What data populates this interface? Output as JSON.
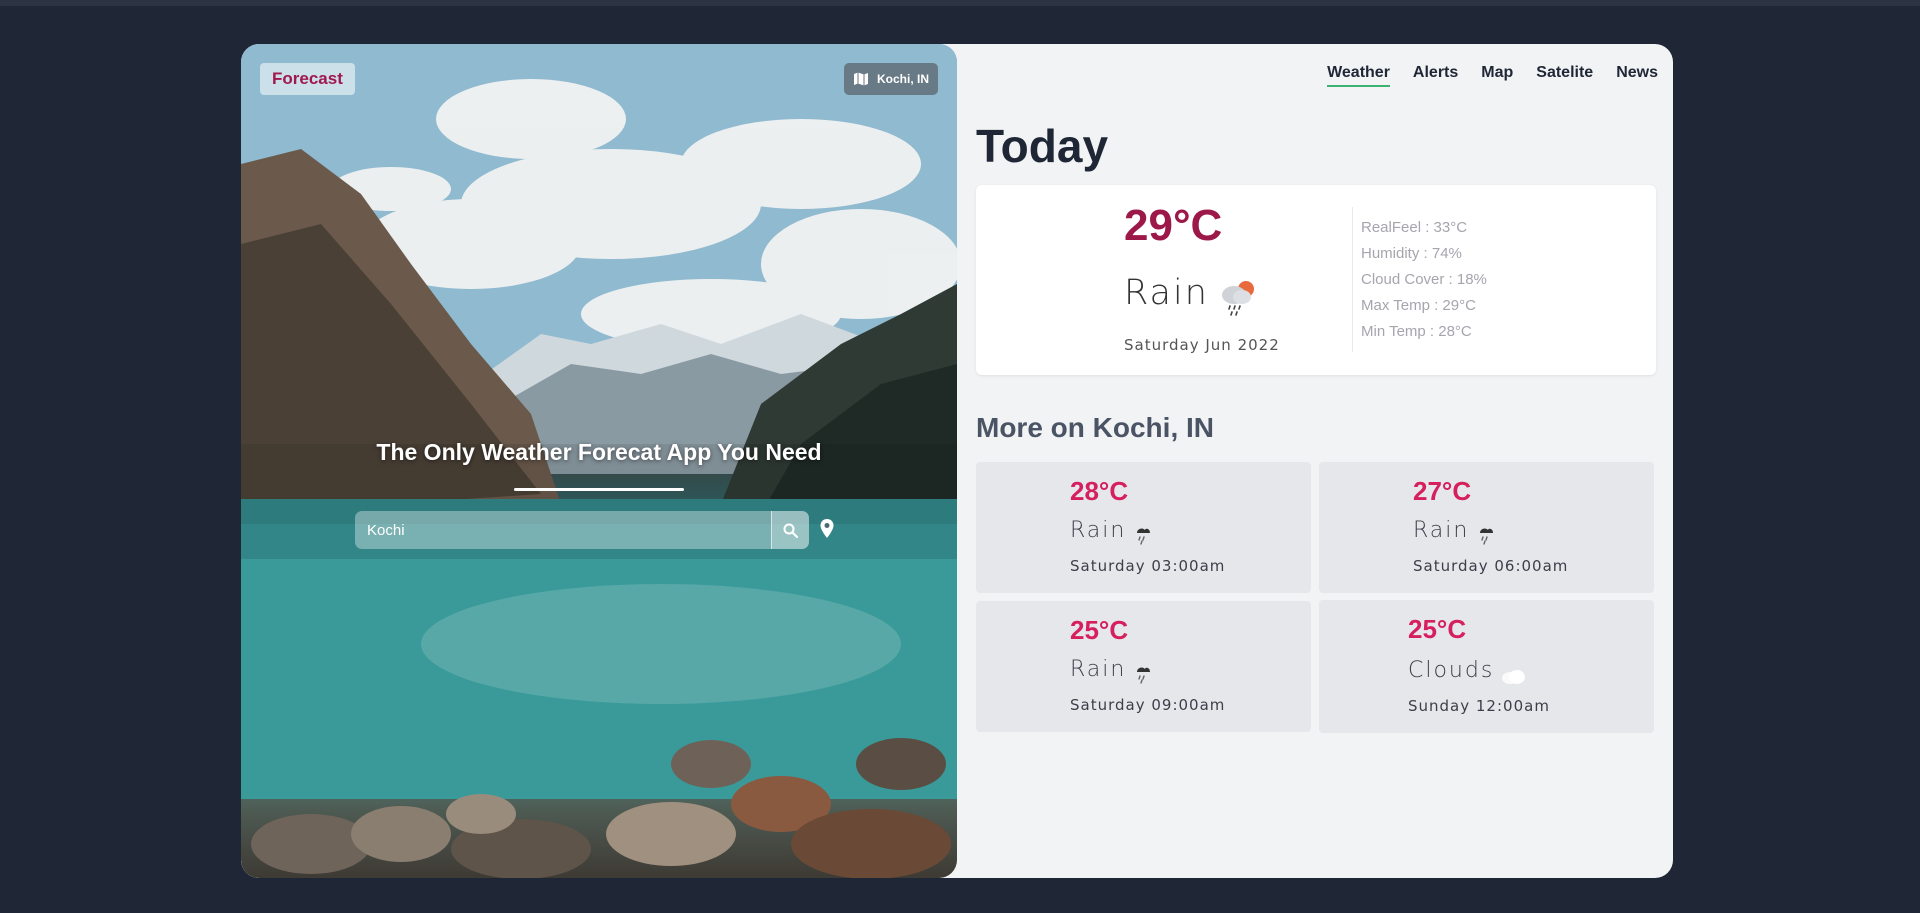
{
  "brand": "Forecast",
  "location_chip": "Kochi, IN",
  "tagline": "The Only Weather Forecat App You Need",
  "search": {
    "value": "Kochi",
    "placeholder": ""
  },
  "nav": [
    "Weather",
    "Alerts",
    "Map",
    "Satelite",
    "News"
  ],
  "today": {
    "title": "Today",
    "temp": "29°C",
    "condition": "Rain",
    "date": "Saturday Jun 2022",
    "stats": [
      "RealFeel : 33°C",
      "Humidity : 74%",
      "Cloud Cover : 18%",
      "Max Temp : 29°C",
      "Min Temp : 28°C"
    ]
  },
  "more": {
    "title": "More on Kochi, IN",
    "cards": [
      {
        "temp": "28°C",
        "condition": "Rain",
        "time": "Saturday 03:00am",
        "icon": "rain-icon"
      },
      {
        "temp": "27°C",
        "condition": "Rain",
        "time": "Saturday 06:00am",
        "icon": "rain-icon"
      },
      {
        "temp": "25°C",
        "condition": "Rain",
        "time": "Saturday 09:00am",
        "icon": "rain-icon"
      },
      {
        "temp": "25°C",
        "condition": "Clouds",
        "time": "Sunday 12:00am",
        "icon": "cloud-icon"
      }
    ]
  },
  "colors": {
    "accent": "#9c1848",
    "forecast_temp": "#d61f5d",
    "nav_active": "#3cb371",
    "background": "#1f2736"
  }
}
